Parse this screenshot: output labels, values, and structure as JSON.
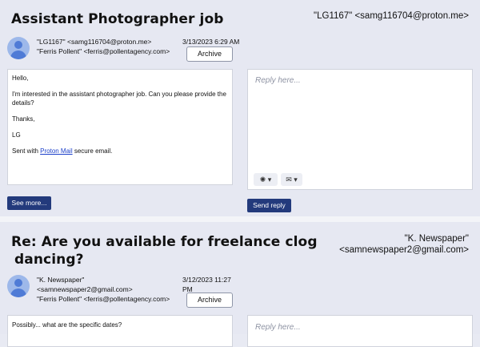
{
  "emails": [
    {
      "subject": "Assistant Photographer job",
      "header_from": "\"LG1167\" <samg116704@proton.me>",
      "sender_line": "\"LG1167\" <samg116704@proton.me>",
      "recipient_line": "\"Ferris Pollent\" <ferris@pollentagency.com>",
      "date": "3/13/2023 6:29 AM",
      "archive_label": "Archive",
      "body": {
        "greeting": "Hello,",
        "text": "I'm interested in the assistant photographer job. Can you please provide the details?",
        "thanks": "Thanks,",
        "signoff": "LG",
        "sent_prefix": "Sent with ",
        "sent_link": "Proton Mail",
        "sent_suffix": " secure email."
      },
      "see_more_label": "See more...",
      "reply_placeholder": "Reply here...",
      "send_label": "Send reply"
    },
    {
      "subject_line1": "Re: Are you available for freelance clog",
      "subject_line2": "dancing?",
      "header_from_name": "\"K. Newspaper\"",
      "header_from_email": "<samnewspaper2@gmail.com>",
      "sender_name": "\"K. Newspaper\"",
      "sender_email": "<samnewspaper2@gmail.com>",
      "recipient_line": "\"Ferris Pollent\" <ferris@pollentagency.com>",
      "date_line1": "3/12/2023 11:27",
      "date_line2": "PM",
      "archive_label": "Archive",
      "body_text": "Possibly... what are the specific dates?",
      "reply_placeholder": "Reply here..."
    }
  ],
  "toolbar": {
    "ai_icon": "openai-icon",
    "template_icon": "envelope-icon"
  }
}
